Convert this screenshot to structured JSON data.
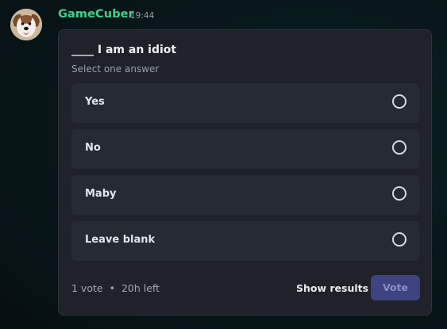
{
  "message": {
    "username": "GameCuber",
    "timestamp": "19:44",
    "username_color": "#3ad38c"
  },
  "poll": {
    "question": "____ I am an idiot",
    "instruction": "Select one answer",
    "answers": [
      {
        "label": "Yes",
        "selected": false
      },
      {
        "label": "No",
        "selected": false
      },
      {
        "label": "Maby",
        "selected": false
      },
      {
        "label": "Leave blank",
        "selected": false
      }
    ],
    "votes": "1 vote",
    "separator": "•",
    "time_left": "20h left",
    "show_results_label": "Show results",
    "vote_label": "Vote",
    "vote_button_color": "#3e4381"
  },
  "icons": {
    "avatar": "dog-avatar",
    "radio": "radio-unchecked-icon"
  }
}
